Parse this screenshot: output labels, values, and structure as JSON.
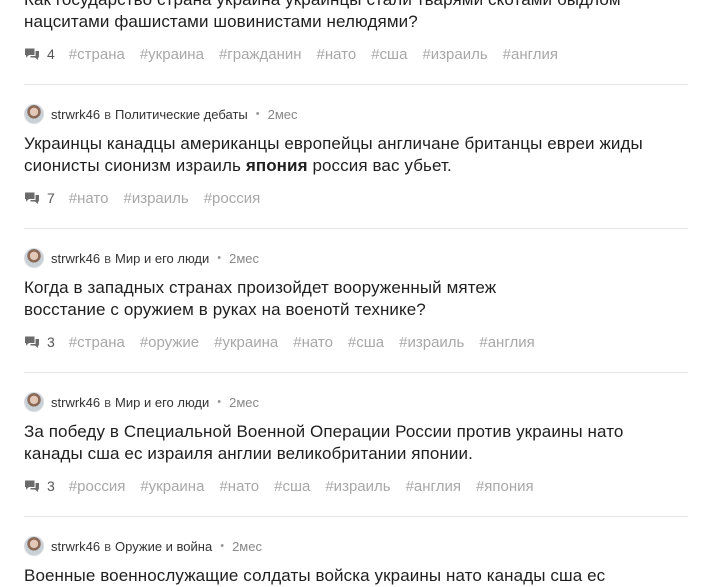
{
  "posts": [
    {
      "title_line1": "Как государство страна украина украинцы стали тварями скотами быдлом",
      "title_line2": "нацситами фашистами шовинистами нелюдями?",
      "comments": "4",
      "tags": [
        "#страна",
        "#украина",
        "#гражданин",
        "#нато",
        "#сша",
        "#израиль",
        "#англия"
      ]
    },
    {
      "author": "strwrk46",
      "in_word": "в",
      "category": "Политические дебаты",
      "time": "2мес",
      "title_line1": "Украинцы канадцы американцы европейцы англичане британцы евреи жиды",
      "title_line2_before": "сионисты сионизм израиль",
      "title_line2_bold": "япония",
      "title_line2_after": "россия вас убьет.",
      "comments": "7",
      "tags": [
        "#нато",
        "#израиль",
        "#россия"
      ]
    },
    {
      "author": "strwrk46",
      "in_word": "в",
      "category": "Мир и его люди",
      "time": "2мес",
      "title_line1": "Когда в западных странах произойдет вооруженный мятеж",
      "title_line2": "восстание с оружием в руках на военотй технике?",
      "comments": "3",
      "tags": [
        "#страна",
        "#оружие",
        "#украина",
        "#нато",
        "#сша",
        "#израиль",
        "#англия"
      ]
    },
    {
      "author": "strwrk46",
      "in_word": "в",
      "category": "Мир и его люди",
      "time": "2мес",
      "title_line1": "За победу в Специальной Военной Операции России против украины нато",
      "title_line2": "канады сша ес израиля англии великобритании японии.",
      "comments": "3",
      "tags": [
        "#россия",
        "#украина",
        "#нато",
        "#сша",
        "#израиль",
        "#англия",
        "#япония"
      ]
    },
    {
      "author": "strwrk46",
      "in_word": "в",
      "category": "Оружие и война",
      "time": "2мес",
      "title_line1": "Военные военнослужащие солдаты войска украины нато канады сша ес"
    }
  ]
}
